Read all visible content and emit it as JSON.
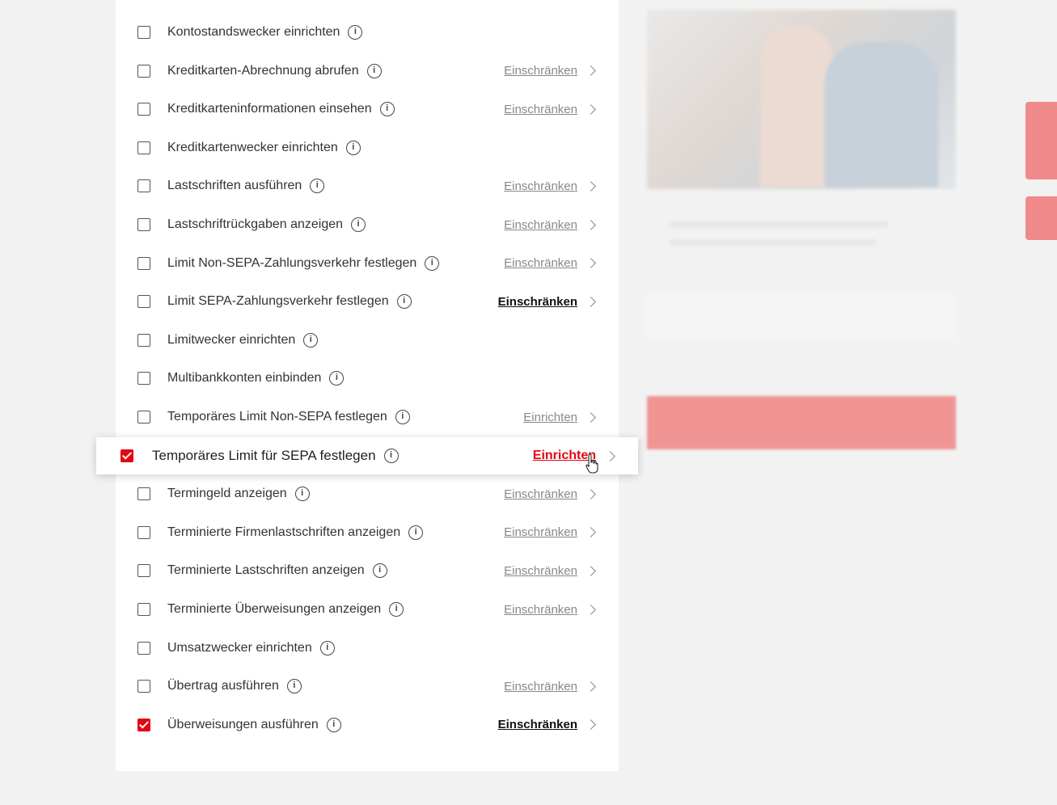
{
  "permissions": [
    {
      "label": "Kontostandswecker einrichten",
      "checked": false,
      "action": ""
    },
    {
      "label": "Kreditkarten-Abrechnung abrufen",
      "checked": false,
      "action": "Einschränken"
    },
    {
      "label": "Kreditkarteninformationen einsehen",
      "checked": false,
      "action": "Einschränken"
    },
    {
      "label": "Kreditkartenwecker einrichten",
      "checked": false,
      "action": ""
    },
    {
      "label": "Lastschriften ausführen",
      "checked": false,
      "action": "Einschränken"
    },
    {
      "label": "Lastschriftrückgaben anzeigen",
      "checked": false,
      "action": "Einschränken"
    },
    {
      "label": "Limit Non-SEPA-Zahlungsverkehr festlegen",
      "checked": false,
      "action": "Einschränken"
    },
    {
      "label": "Limit SEPA-Zahlungsverkehr festlegen",
      "checked": false,
      "action": "Einschränken",
      "bold": true
    },
    {
      "label": "Limitwecker einrichten",
      "checked": false,
      "action": ""
    },
    {
      "label": "Multibankkonten einbinden",
      "checked": false,
      "action": ""
    },
    {
      "label": "Temporäres Limit Non-SEPA festlegen",
      "checked": false,
      "action": "Einrichten"
    },
    {
      "label": "Temporäres Limit für SEPA festlegen",
      "checked": true,
      "action": "Einrichten",
      "highlighted": true
    },
    {
      "label": "Termingeld anzeigen",
      "checked": false,
      "action": "Einschränken"
    },
    {
      "label": "Terminierte Firmenlastschriften anzeigen",
      "checked": false,
      "action": "Einschränken"
    },
    {
      "label": "Terminierte Lastschriften anzeigen",
      "checked": false,
      "action": "Einschränken"
    },
    {
      "label": "Terminierte Überweisungen anzeigen",
      "checked": false,
      "action": "Einschränken"
    },
    {
      "label": "Umsatzwecker einrichten",
      "checked": false,
      "action": ""
    },
    {
      "label": "Übertrag ausführen",
      "checked": false,
      "action": "Einschränken"
    },
    {
      "label": "Überweisungen ausführen",
      "checked": true,
      "action": "Einschränken",
      "bold": true
    }
  ],
  "colors": {
    "accent": "#e30613",
    "page_background": "#f2f2f2"
  },
  "icons": {
    "info": "info-circle-icon",
    "chevron": "chevron-right-icon",
    "cursor": "hand-pointer-icon"
  }
}
